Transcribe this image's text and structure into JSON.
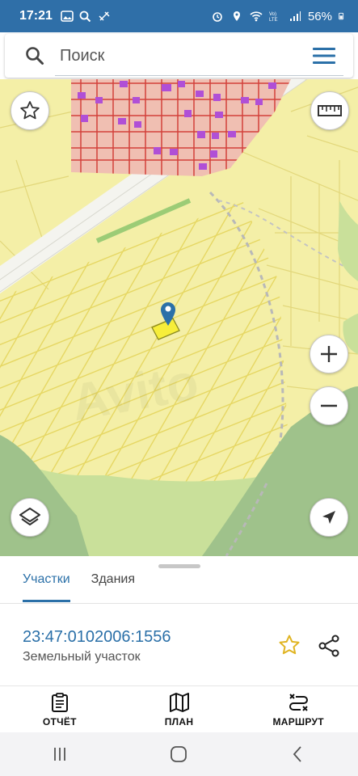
{
  "status_bar": {
    "time": "17:21",
    "battery": "56%",
    "icons": [
      "image-icon",
      "search-icon",
      "vpn-icon",
      "alarm-icon",
      "location-icon",
      "wifi-icon",
      "volte-icon",
      "signal-icon",
      "battery-icon"
    ]
  },
  "search": {
    "placeholder": "Поиск",
    "value": ""
  },
  "map": {
    "controls": [
      "favorite-star-icon",
      "ruler-icon",
      "zoom-in-icon",
      "zoom-out-icon",
      "layers-icon",
      "my-location-icon"
    ],
    "marker": "map-pin-icon",
    "colors": {
      "base": "#f4efa7",
      "grid_lines": "#e8d86a",
      "built_area": "#f0b8b0",
      "built_lines": "#d2413a",
      "buildings": "#b04fd6",
      "forest": "#a8c690",
      "meadow": "#c9e09a",
      "road": "#f2f2ee",
      "selected_parcel": "#f7ee3a"
    }
  },
  "sheet": {
    "tabs": [
      {
        "label": "Участки",
        "active": true
      },
      {
        "label": "Здания",
        "active": false
      }
    ],
    "parcel_number": "23:47:0102006:1556",
    "parcel_type": "Земельный участок",
    "accent_color": "#2b70a8",
    "star_color": "#e0b422"
  },
  "bottom_nav": [
    {
      "label": "ОТЧЁТ",
      "icon": "report-icon"
    },
    {
      "label": "ПЛАН",
      "icon": "map-plan-icon"
    },
    {
      "label": "МАРШРУТ",
      "icon": "route-icon"
    }
  ],
  "system_nav": [
    "recent-apps-icon",
    "home-icon",
    "back-icon"
  ]
}
